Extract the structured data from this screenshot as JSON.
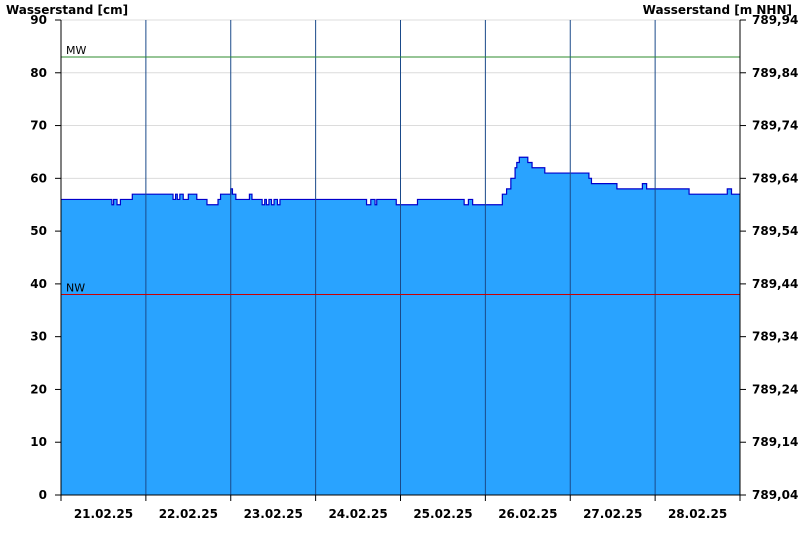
{
  "chart_data": {
    "type": "area",
    "ylabel_left": "Wasserstand [cm]",
    "ylabel_right": "Wasserstand [m NHN]",
    "ylim_left": [
      0,
      90
    ],
    "ylim_right": [
      789.04,
      789.94
    ],
    "left_ticks": [
      "0",
      "10",
      "20",
      "30",
      "40",
      "50",
      "60",
      "70",
      "80",
      "90"
    ],
    "right_ticks": [
      "789,04",
      "789,14",
      "789,24",
      "789,34",
      "789,44",
      "789,54",
      "789,64",
      "789,74",
      "789,84",
      "789,94"
    ],
    "x_start": "21.02.25 00:00",
    "x_end": "29.02.25 00:00",
    "x_ticks": [
      "21.02.25",
      "22.02.25",
      "23.02.25",
      "24.02.25",
      "25.02.25",
      "26.02.25",
      "27.02.25",
      "28.02.25"
    ],
    "reference_lines": [
      {
        "label": "MW",
        "value": 83,
        "color": "#2e8b2e"
      },
      {
        "label": "NW",
        "value": 38,
        "color": "#cc0000"
      }
    ],
    "series": [
      {
        "color": "#29a3ff",
        "line_color": "#0000cc",
        "x_day": [
          0,
          0.55,
          0.6,
          0.62,
          0.66,
          0.7,
          0.82,
          0.84,
          1.3,
          1.32,
          1.35,
          1.37,
          1.4,
          1.44,
          1.48,
          1.5,
          1.53,
          1.6,
          1.7,
          1.72,
          1.85,
          1.88,
          1.97,
          2.0,
          2.02,
          2.04,
          2.06,
          2.2,
          2.22,
          2.25,
          2.35,
          2.37,
          2.4,
          2.42,
          2.45,
          2.48,
          2.51,
          2.55,
          2.58,
          2.6,
          2.62,
          2.65,
          2.7,
          2.85,
          3.0,
          3.55,
          3.6,
          3.65,
          3.7,
          3.72,
          3.8,
          3.95,
          4.2,
          4.4,
          4.48,
          4.5,
          4.75,
          4.8,
          4.85,
          4.88,
          4.92,
          5.0,
          5.05,
          5.1,
          5.2,
          5.25,
          5.3,
          5.35,
          5.37,
          5.4,
          5.45,
          5.5,
          5.55,
          5.6,
          5.7,
          5.85,
          5.9,
          6.0,
          6.2,
          6.22,
          6.25,
          6.3,
          6.35,
          6.5,
          6.55,
          6.7,
          6.85,
          6.9,
          6.95,
          7.0,
          7.05,
          7.4,
          7.45,
          7.83,
          7.85,
          7.9,
          8.0
        ],
        "y": [
          56,
          56,
          55,
          56,
          55,
          56,
          56,
          57,
          57,
          56,
          57,
          56,
          57,
          56,
          56,
          57,
          57,
          56,
          56,
          55,
          56,
          57,
          57,
          58,
          57,
          57,
          56,
          56,
          57,
          56,
          56,
          55,
          56,
          55,
          56,
          55,
          56,
          55,
          56,
          56,
          56,
          56,
          56,
          56,
          56,
          56,
          55,
          56,
          55,
          56,
          56,
          55,
          56,
          56,
          56,
          56,
          55,
          56,
          55,
          55,
          55,
          55,
          55,
          55,
          57,
          58,
          60,
          62,
          63,
          64,
          64,
          63,
          62,
          62,
          61,
          61,
          61,
          61,
          61,
          60,
          59,
          59,
          59,
          59,
          58,
          58,
          59,
          58,
          58,
          58,
          58,
          57,
          57,
          57,
          58,
          57,
          57
        ]
      }
    ]
  }
}
